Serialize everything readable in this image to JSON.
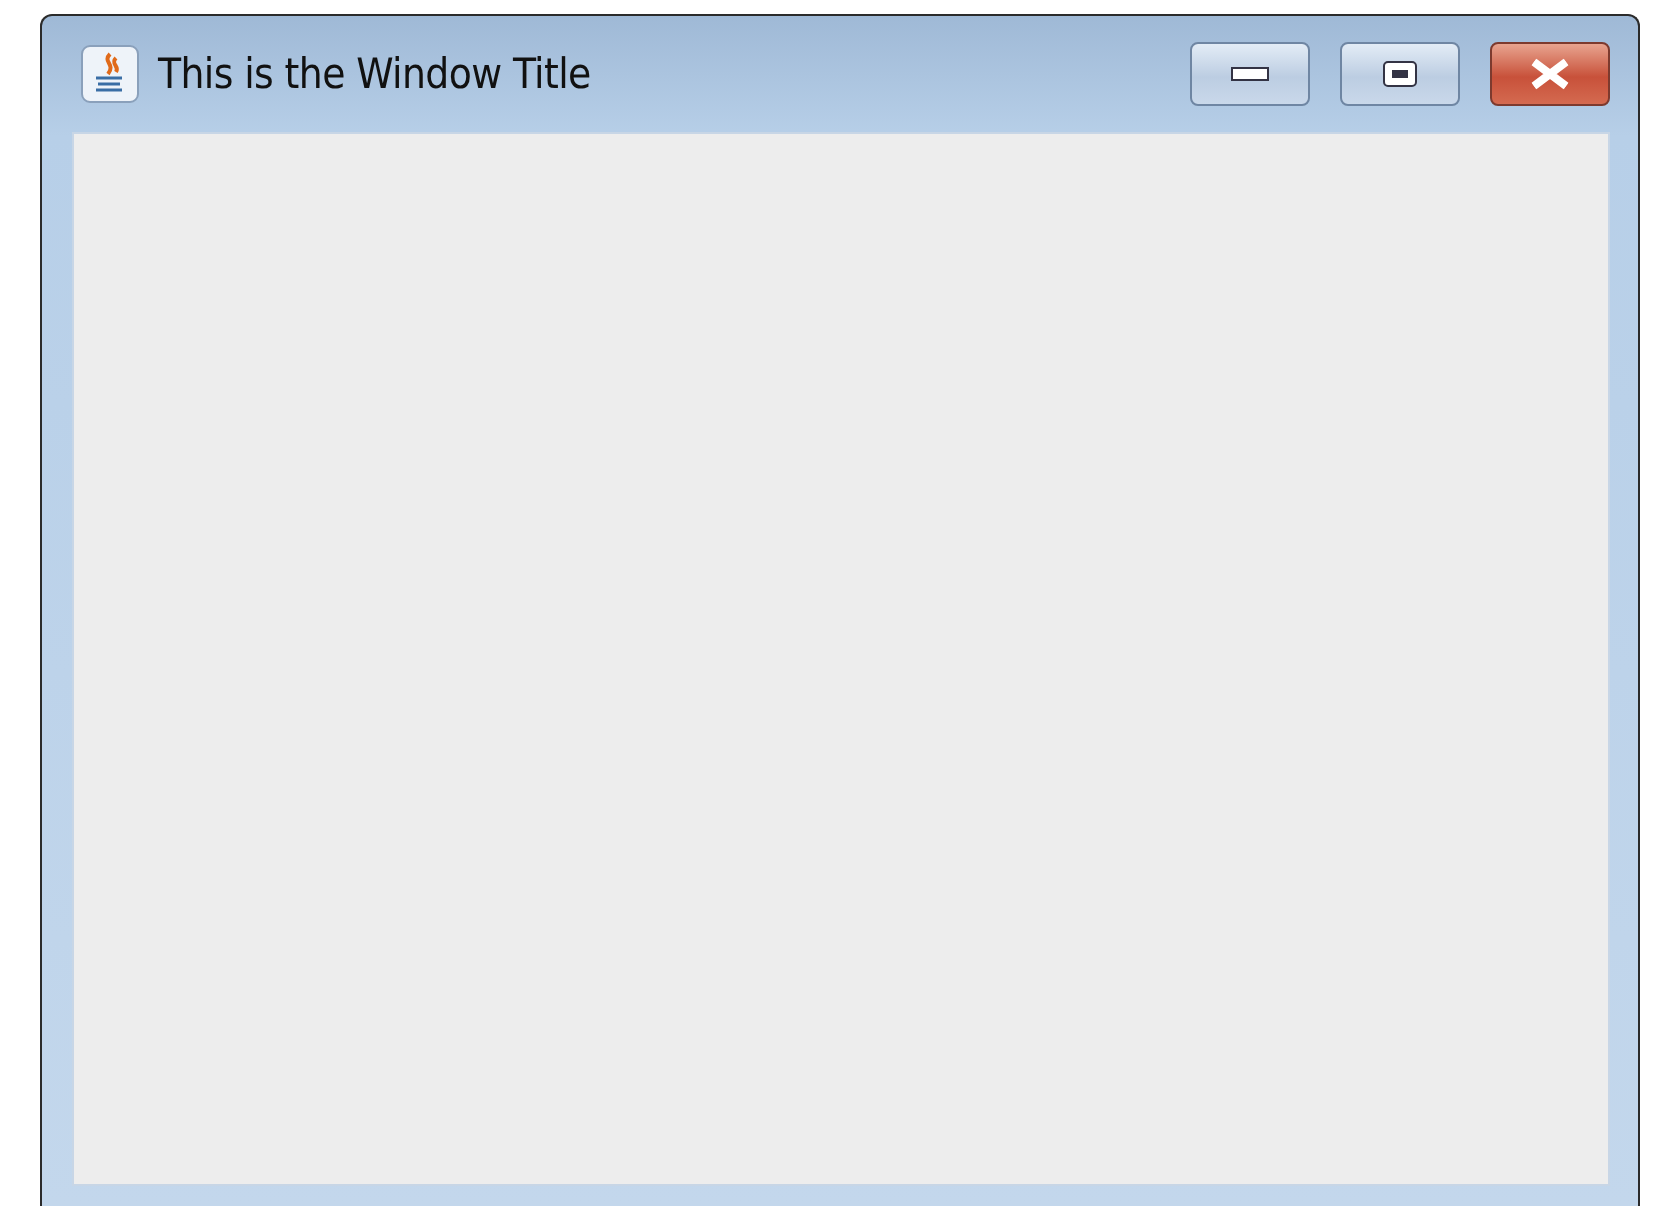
{
  "window": {
    "title": "This is the Window Title",
    "controls": [
      {
        "kind": "minimize"
      },
      {
        "kind": "maximize"
      },
      {
        "kind": "close"
      }
    ]
  }
}
